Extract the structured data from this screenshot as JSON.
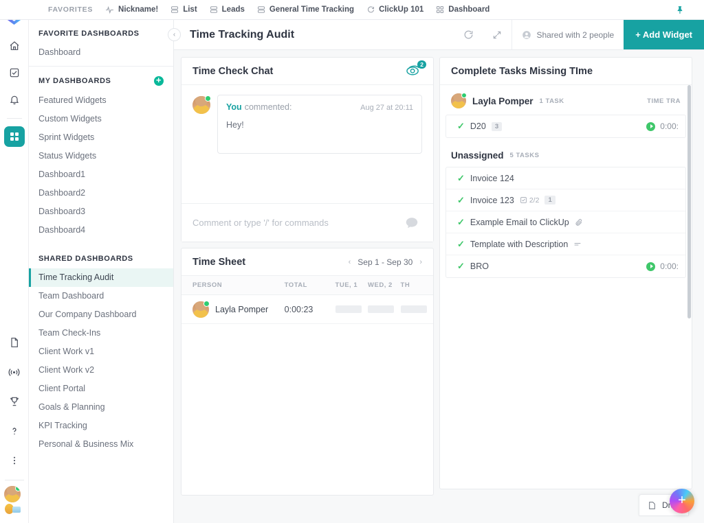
{
  "topbar": {
    "favorites_label": "FAVORITES",
    "items": [
      {
        "label": "Nickname!",
        "icon": "pulse-icon"
      },
      {
        "label": "List",
        "icon": "list-icon"
      },
      {
        "label": "Leads",
        "icon": "list-icon"
      },
      {
        "label": "General Time Tracking",
        "icon": "list-icon"
      },
      {
        "label": "ClickUp 101",
        "icon": "circle-icon"
      },
      {
        "label": "Dashboard",
        "icon": "grid-icon"
      }
    ],
    "pin_icon": "pin-icon"
  },
  "rail": {
    "logo": "clickup-logo",
    "top_icons": [
      {
        "name": "home-icon"
      },
      {
        "name": "tasks-icon"
      },
      {
        "name": "notifications-icon"
      }
    ],
    "active_icon": {
      "name": "dashboards-icon"
    },
    "bottom_icons": [
      {
        "name": "docs-icon"
      },
      {
        "name": "broadcast-icon"
      },
      {
        "name": "goals-trophy-icon"
      },
      {
        "name": "help-icon"
      },
      {
        "name": "more-options-icon"
      }
    ],
    "avatar": "user-avatar"
  },
  "sidebar": {
    "favorite_section": {
      "title": "FAVORITE DASHBOARDS",
      "items": [
        "Dashboard"
      ]
    },
    "my_section": {
      "title": "MY DASHBOARDS",
      "add_icon": "plus-icon",
      "items": [
        "Featured Widgets",
        "Custom Widgets",
        "Sprint Widgets",
        "Status Widgets",
        "Dashboard1",
        "Dashboard2",
        "Dashboard3",
        "Dashboard4"
      ]
    },
    "shared_section": {
      "title": "SHARED DASHBOARDS",
      "active": "Time Tracking Audit",
      "items": [
        "Time Tracking Audit",
        "Team Dashboard",
        "Our Company Dashboard",
        "Team Check-Ins",
        "Client Work v1",
        "Client Work v2",
        "Client Portal",
        "Goals & Planning",
        "KPI Tracking",
        "Personal & Business Mix"
      ]
    }
  },
  "header": {
    "collapse_icon": "chevron-left-icon",
    "title": "Time Tracking Audit",
    "refresh_icon": "refresh-icon",
    "expand_icon": "expand-icon",
    "shared_icon": "person-icon",
    "shared_label": "Shared with 2 people",
    "add_widget_label": "+ Add Widget"
  },
  "chat_widget": {
    "title": "Time Check Chat",
    "watchers_icon": "eye-icon",
    "watchers_count": "2",
    "message": {
      "author": "You",
      "action": "commented:",
      "timestamp": "Aug 27 at 20:11",
      "text": "Hey!"
    },
    "input_placeholder": "Comment or type '/' for commands",
    "input_value": "",
    "send_icon": "comment-bubble-icon"
  },
  "timesheet_widget": {
    "title": "Time Sheet",
    "prev_icon": "chevron-left-icon",
    "date_range": "Sep 1 - Sep 30",
    "next_icon": "chevron-right-icon",
    "columns": [
      "PERSON",
      "TOTAL",
      "TUE, 1",
      "WED, 2",
      "TH"
    ],
    "rows": [
      {
        "person": "Layla Pomper",
        "total": "0:00:23",
        "days": [
          "",
          "",
          ""
        ]
      }
    ]
  },
  "tasks_widget": {
    "title": "Complete Tasks Missing TIme",
    "time_column_header": "TIME TRA",
    "groups": [
      {
        "name": "Layla Pomper",
        "count": "1 TASK",
        "avatar": "assignee-avatar",
        "tasks": [
          {
            "name": "D20",
            "badge": "3",
            "time": "0:00:",
            "has_time": true,
            "icons": []
          }
        ]
      },
      {
        "name": "Unassigned",
        "count": "5 TASKS",
        "avatar": "",
        "tasks": [
          {
            "name": "Invoice 124",
            "badge": "",
            "time": "",
            "has_time": false,
            "icons": []
          },
          {
            "name": "Invoice 123",
            "badge": "1",
            "time": "",
            "has_time": false,
            "icons": [
              "checklist-icon"
            ],
            "checklist": "2/2"
          },
          {
            "name": "Example Email to ClickUp",
            "badge": "",
            "time": "",
            "has_time": false,
            "icons": [
              "attachment-icon"
            ]
          },
          {
            "name": "Template with Description",
            "badge": "",
            "time": "",
            "has_time": false,
            "icons": [
              "description-icon"
            ]
          },
          {
            "name": "BRO",
            "badge": "",
            "time": "0:00:",
            "has_time": true,
            "icons": []
          }
        ]
      }
    ]
  },
  "overlays": {
    "draft_label": "Draft",
    "draft_icon": "document-icon",
    "fab_icon": "plus-icon"
  },
  "colors": {
    "accent": "#17a2a2",
    "green": "#3fc76a",
    "canvas": "#f7f8f9",
    "text": "#2f3542"
  }
}
